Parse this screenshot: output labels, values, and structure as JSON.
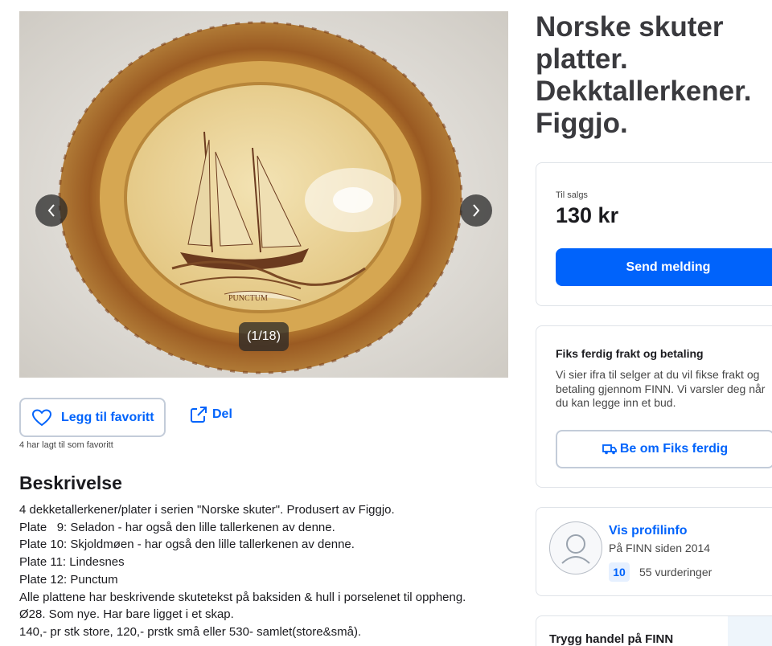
{
  "listing": {
    "title": "Norske skuter platter. Dekktallerkener. Figgjo."
  },
  "gallery": {
    "counter": "(1/18)",
    "plate_caption": "PUNCTUM",
    "prev_icon": "chevron-left-icon",
    "next_icon": "chevron-right-icon"
  },
  "actions": {
    "favorite_label": "Legg til favoritt",
    "share_label": "Del",
    "favorite_count_text": "4 har lagt til som favoritt"
  },
  "description": {
    "heading": "Beskrivelse",
    "lines": [
      "4 dekketallerkener/plater i serien \"Norske skuter\". Produsert av Figgjo.",
      "Plate   9: Seladon - har også den lille tallerkenen av denne.",
      "Plate 10: Skjoldmøen - har også den lille tallerkenen av denne.",
      "Plate 11: Lindesnes",
      "Plate 12: Punctum",
      "Alle plattene har beskrivende skutetekst på baksiden & hull i porselenet til oppheng.",
      "Ø28. Som nye. Har bare ligget i et skap.",
      "140,- pr stk store, 120,- prstk små eller 530- samlet(store&små)."
    ]
  },
  "price_card": {
    "label": "Til salgs",
    "price": "130 kr",
    "send_button": "Send melding"
  },
  "fiks_card": {
    "title": "Fiks ferdig frakt og betaling",
    "text": "Vi sier ifra til selger at du vil fikse frakt og betaling gjennom FINN. Vi varsler deg når du kan legge inn et bud.",
    "button": "Be om Fiks ferdig"
  },
  "profile_card": {
    "link": "Vis profilinfo",
    "since": "På FINN siden 2014",
    "rating_score": "10",
    "rating_count": "55 vurderinger"
  },
  "safe_card": {
    "title": "Trygg handel på FINN"
  },
  "colors": {
    "accent": "#0063fb",
    "border": "#dfe3e8",
    "button_border": "#c3ccd9"
  }
}
